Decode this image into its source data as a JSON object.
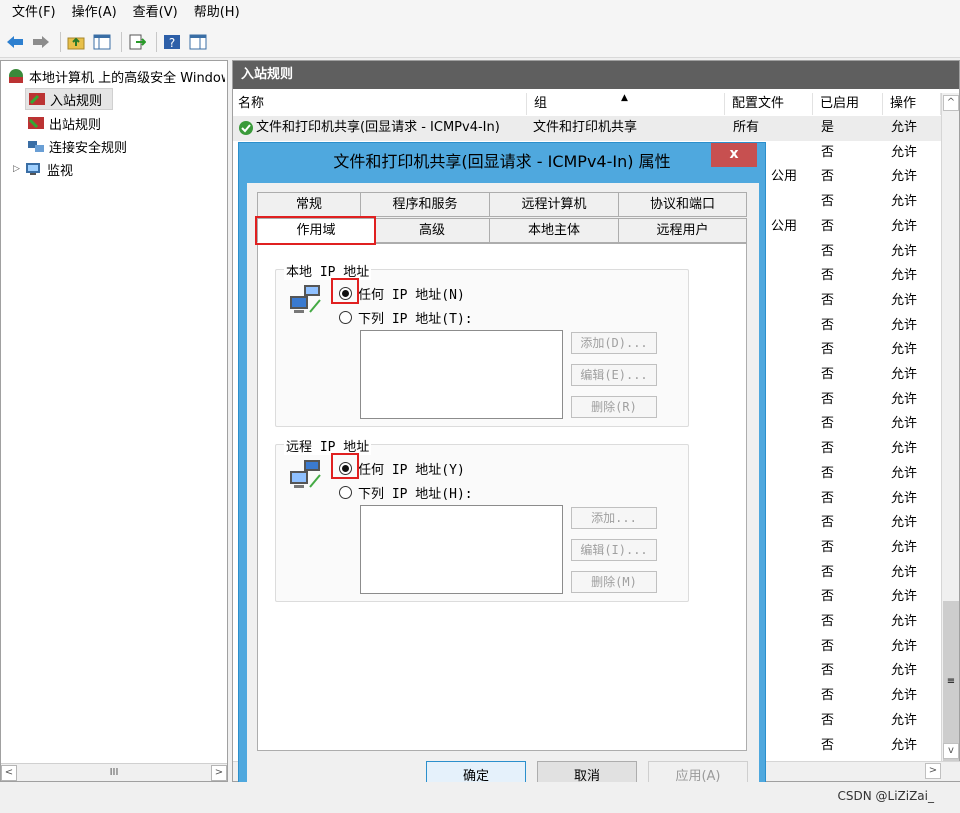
{
  "menu": [
    "文件(F)",
    "操作(A)",
    "查看(V)",
    "帮助(H)"
  ],
  "tree": {
    "root": "本地计算机 上的高级安全 Windows Defender 防火墙",
    "items": [
      "入站规则",
      "出站规则",
      "连接安全规则",
      "监视"
    ]
  },
  "right": {
    "title": "入站规则",
    "columns": [
      "名称",
      "组",
      "配置文件",
      "已启用",
      "操作"
    ],
    "first_row": {
      "name": "文件和打印机共享(回显请求 - ICMPv4-In)",
      "group": "文件和打印机共享",
      "profile": "所有",
      "enabled": "是",
      "action": "允许"
    },
    "profile_labels": [
      "公用",
      "公用"
    ],
    "row_enabled": "否",
    "row_action": "允许"
  },
  "dialog": {
    "title": "文件和打印机共享(回显请求 - ICMPv4-In) 属性",
    "close": "x",
    "tabs_top": [
      "常规",
      "程序和服务",
      "远程计算机",
      "协议和端口"
    ],
    "tabs_bottom": [
      "作用域",
      "高级",
      "本地主体",
      "远程用户"
    ],
    "local": {
      "title": "本地 IP 地址",
      "any": "任何 IP 地址(N)",
      "list": "下列 IP 地址(T):",
      "add": "添加(D)...",
      "edit": "编辑(E)...",
      "remove": "删除(R)"
    },
    "remote": {
      "title": "远程 IP 地址",
      "any": "任何 IP 地址(Y)",
      "list": "下列 IP 地址(H):",
      "add": "添加...",
      "edit": "编辑(I)...",
      "remove": "删除(M)"
    },
    "ok": "确定",
    "cancel": "取消",
    "apply": "应用(A)"
  },
  "scroll": {
    "h_thumb": "III",
    "v_thumb": "≡"
  },
  "watermark": "CSDN @LiZiZai_"
}
